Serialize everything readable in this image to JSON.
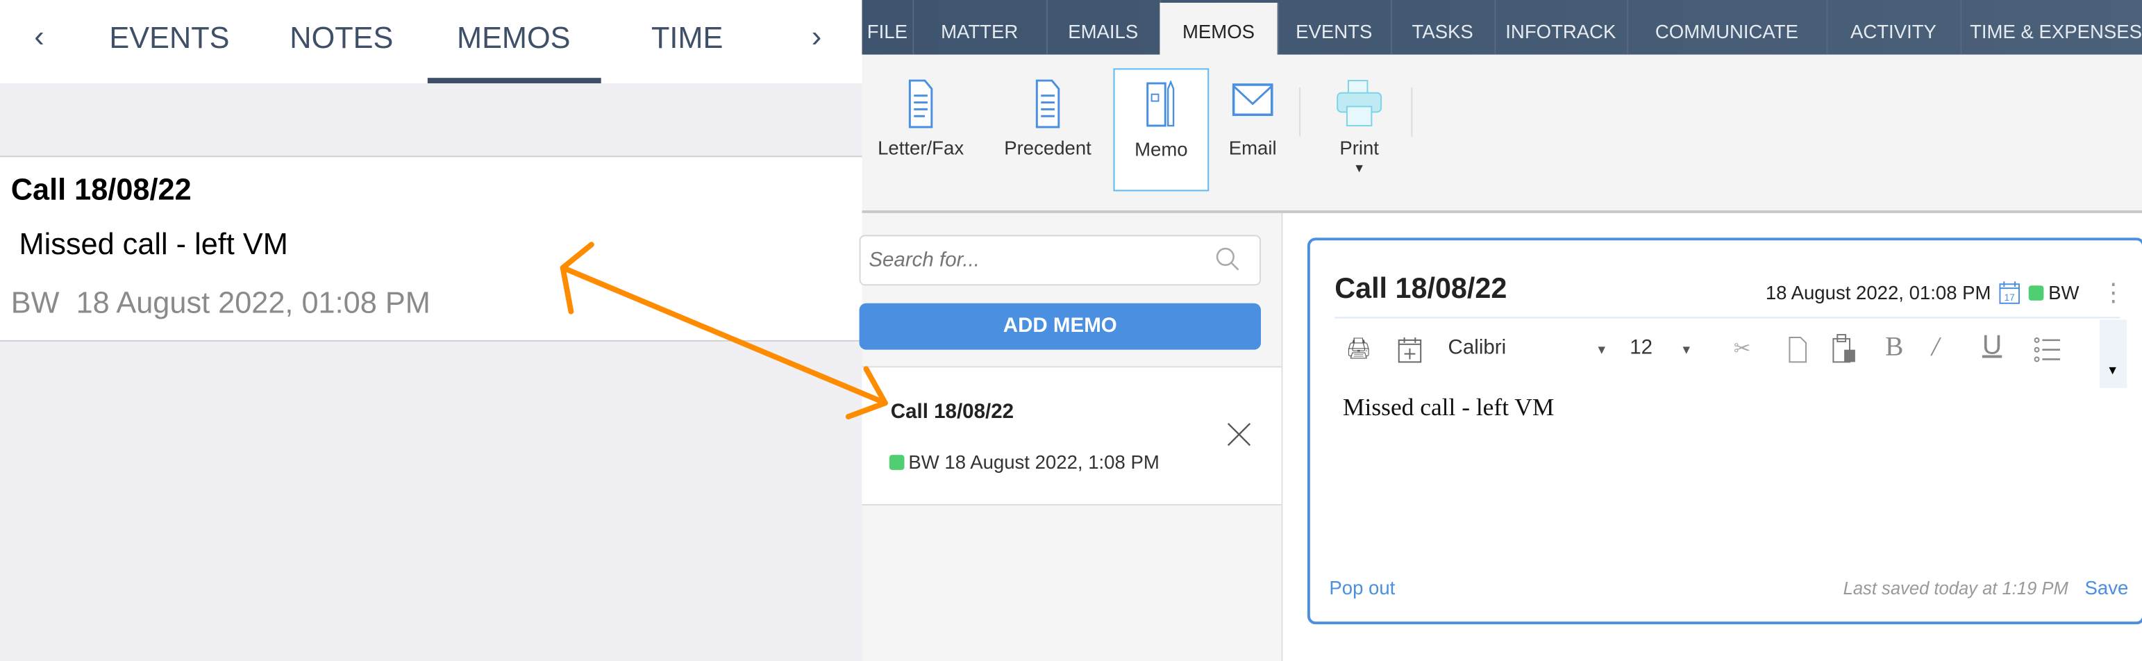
{
  "mobile": {
    "tabs": [
      "EVENTS",
      "NOTES",
      "MEMOS",
      "TIME"
    ],
    "active_tab": "MEMOS",
    "prev_icon": "chevron-left-icon",
    "next_icon": "chevron-right-icon",
    "memo": {
      "title": "Call 18/08/22",
      "body": "Missed call - left VM",
      "author": "BW",
      "datetime": "18 August 2022, 01:08 PM"
    }
  },
  "desktop": {
    "nav_tabs": [
      "FILE",
      "MATTER",
      "EMAILS",
      "MEMOS",
      "EVENTS",
      "TASKS",
      "INFOTRACK",
      "COMMUNICATE",
      "ACTIVITY",
      "TIME & EXPENSES"
    ],
    "active_tab": "MEMOS",
    "ribbon": {
      "letter": "Letter/Fax",
      "precedent": "Precedent",
      "memo": "Memo",
      "email": "Email",
      "print": "Print"
    },
    "search_placeholder": "Search for...",
    "add_memo": "ADD MEMO",
    "list": [
      {
        "title": "Call 18/08/22",
        "author": "BW",
        "datetime": "18 August 2022, 1:08 PM"
      }
    ],
    "editor": {
      "title": "Call 18/08/22",
      "datetime": "18 August 2022, 01:08 PM",
      "author": "BW",
      "font": "Calibri",
      "size": "12",
      "body": "Missed call - left VM",
      "pop_out": "Pop out",
      "last_saved": "Last saved today at 1:19 PM",
      "save": "Save"
    }
  },
  "colors": {
    "accent": "#4a8fe0",
    "nav": "#415670",
    "annotation_arrow": "#ff8c00",
    "author_badge": "#4fcf72"
  }
}
